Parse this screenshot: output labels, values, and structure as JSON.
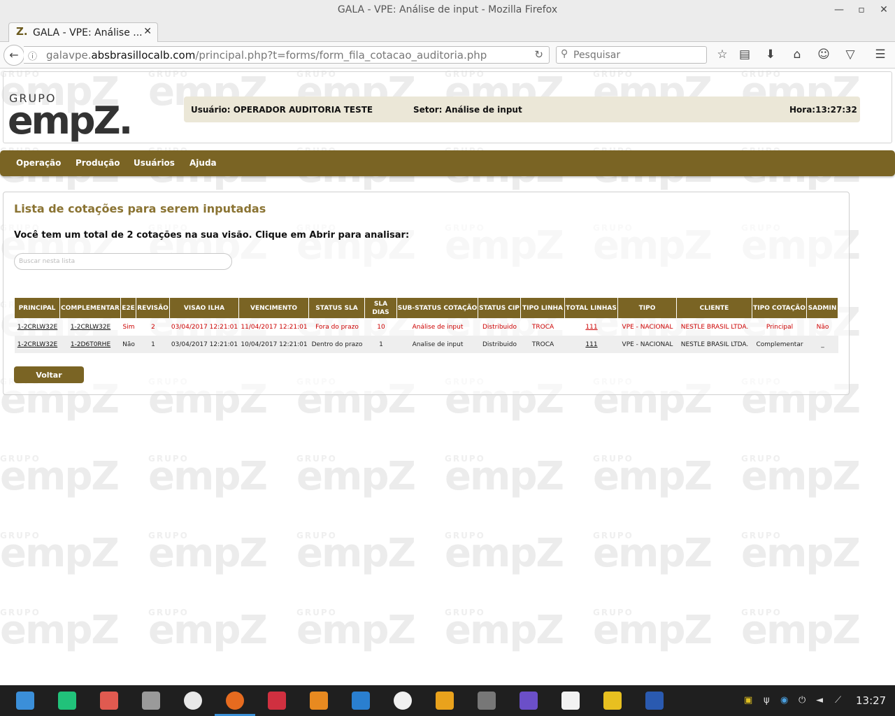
{
  "browser": {
    "window_title": "GALA - VPE: Análise de input - Mozilla Firefox",
    "tab_favicon": "Z.",
    "tab_title": "GALA - VPE: Análise ...",
    "tab_close": "✕",
    "new_tab": "+",
    "url_prefix": "galavpe.",
    "url_domain": "absbrasillocalb.com",
    "url_path": "/principal.php?t=forms/form_fila_cotacao_auditoria.php",
    "search_placeholder": "Pesquisar",
    "icons": [
      "bookmark-star-icon",
      "reading-list-icon",
      "download-icon",
      "home-icon",
      "smiley-icon",
      "pocket-icon",
      "menu-icon"
    ]
  },
  "header": {
    "logo_group": "GRUPO",
    "logo_brand": "empZ.",
    "user": "Usuário: OPERADOR AUDITORIA TESTE",
    "sector": "Setor: Análise de input",
    "time": "Hora:13:27:32"
  },
  "menu": {
    "items": [
      "Operação",
      "Produção",
      "Usuários",
      "Ajuda"
    ]
  },
  "content": {
    "title": "Lista de cotações para serem inputadas",
    "subtitle": "Você tem um total de 2 cotações na sua visão. Clique em Abrir para analisar:",
    "filter_placeholder": "Buscar nesta lista",
    "back_button": "Voltar"
  },
  "table": {
    "columns": [
      "PRINCIPAL",
      "COMPLEMENTAR",
      "E2E",
      "REVISÃO",
      "VISAO ILHA",
      "VENCIMENTO",
      "STATUS SLA",
      "SLA DIAS",
      "SUB-STATUS COTAÇÃO",
      "STATUS CIP",
      "TIPO LINHA",
      "TOTAL LINHAS",
      "TIPO",
      "CLIENTE",
      "TIPO COTAÇÃO",
      "SADMIN"
    ],
    "rows": [
      [
        "1-2CRLW32E",
        "1-2CRLW32E",
        "Sim",
        "2",
        "03/04/2017 12:21:01",
        "11/04/2017 12:21:01",
        "Fora do prazo",
        "10",
        "Análise de input",
        "Distribuido",
        "TROCA",
        "111",
        "VPE - NACIONAL",
        "NESTLE BRASIL LTDA.",
        "Principal",
        "Não"
      ],
      [
        "1-2CRLW32E",
        "1-2D6T0RHE",
        "Não",
        "1",
        "03/04/2017 12:21:01",
        "10/04/2017 12:21:01",
        "Dentro do prazo",
        "1",
        "Analise de input",
        "Distribuido",
        "TROCA",
        "111",
        "VPE - NACIONAL",
        "NESTLE BRASIL LTDA.",
        "Complementar",
        "_"
      ]
    ],
    "row_colors": [
      "#cc0000",
      "#222222"
    ]
  },
  "watermark": {
    "small": "GRUPO",
    "big": "empZ"
  },
  "taskbar": {
    "clock": "13:27",
    "apps": [
      "app-launcher-icon",
      "terminal-green-icon",
      "screen-recorder-icon",
      "file-cabinet-icon",
      "chrome-icon",
      "firefox-icon",
      "terminal-red-icon",
      "archive-icon",
      "video-editor-icon",
      "settings-gear-icon",
      "outlook-icon",
      "sublime-text-icon",
      "app-purple-icon",
      "notepad-icon",
      "yellow-app-icon",
      "word-icon"
    ],
    "accent": "#3a8fd6"
  },
  "theme": {
    "brand": "#7a6424",
    "title_gold": "#8a7332",
    "infobar_bg": "#ebe7d7"
  }
}
